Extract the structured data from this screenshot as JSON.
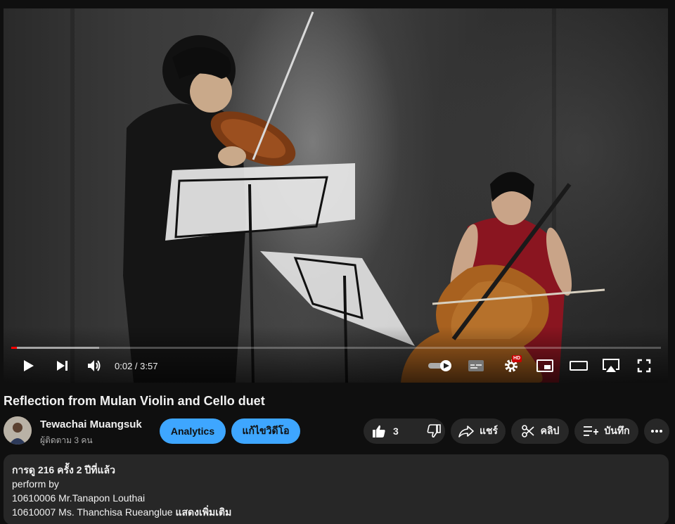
{
  "player": {
    "time_current": "0:02",
    "time_separator": " / ",
    "time_total": "3:57",
    "progress_played": 0.009,
    "progress_loaded": 0.135,
    "hd_badge": "HD",
    "icons": [
      "play-icon",
      "next-icon",
      "volume-icon",
      "autoplay-toggle",
      "subtitles-icon",
      "settings-icon",
      "miniplayer-icon",
      "theater-icon",
      "airplay-icon",
      "fullscreen-icon"
    ]
  },
  "video": {
    "title": "Reflection from Mulan Violin and Cello duet"
  },
  "channel": {
    "name": "Tewachai Muangsuk",
    "subscribers": "ผู้ติดตาม 3 คน"
  },
  "actions": {
    "analytics_label": "Analytics",
    "edit_label": "แก้ไขวิดีโอ",
    "like_count": "3",
    "share_label": "แชร์",
    "clip_label": "คลิป",
    "save_label": "บันทึก"
  },
  "description": {
    "meta": "การดู 216 ครั้ง  2 ปีที่แล้ว",
    "line1": "perform by",
    "line2": "10610006 Mr.Tanapon Louthai",
    "line3": "10610007 Ms. Thanchisa Rueanglue",
    "more": " แสดงเพิ่มเติม"
  },
  "colors": {
    "accent_blue": "#3ea6ff",
    "progress_red": "#ff0000",
    "background": "#0f0f0f",
    "button_dark": "#272727"
  }
}
